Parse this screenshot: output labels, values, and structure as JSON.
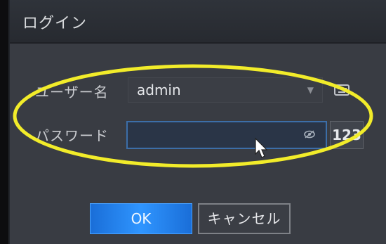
{
  "window": {
    "title": "ログイン"
  },
  "form": {
    "username_label": "ユーザー名",
    "username_value": "admin",
    "password_label": "パスワード",
    "password_value": "",
    "numeric_toggle_label": "123"
  },
  "actions": {
    "ok_label": "OK",
    "cancel_label": "キャンセル"
  },
  "icons": {
    "dropdown": "chevron-down-icon",
    "keyboard": "keyboard-icon",
    "show_password": "eye-icon",
    "pointer": "mouse-cursor-icon"
  },
  "colors": {
    "accent": "#2f95ff",
    "highlight_annotation": "#f2ec2a",
    "background": "#393c43"
  }
}
